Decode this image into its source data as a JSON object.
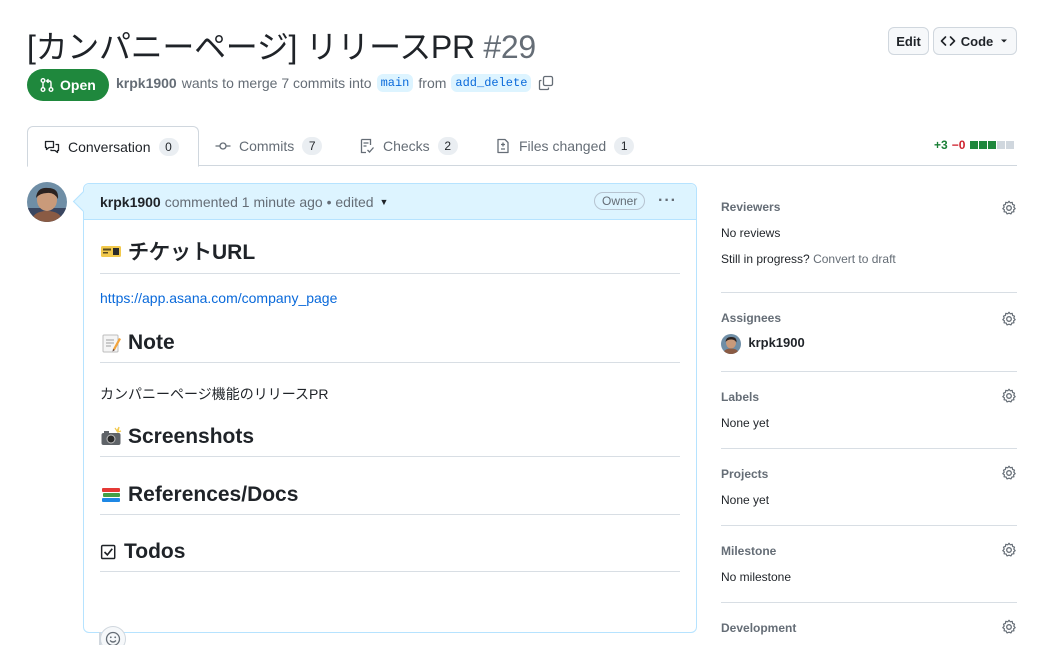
{
  "header": {
    "title": "[カンパニーページ] リリースPR",
    "number": "#29",
    "edit_label": "Edit",
    "code_label": "Code"
  },
  "status": {
    "state_label": "Open",
    "author": "krpk1900",
    "merge_text": "wants to merge 7 commits into",
    "base_branch": "main",
    "from_text": "from",
    "head_branch": "add_delete"
  },
  "tabs": [
    {
      "label": "Conversation",
      "count": "0",
      "icon": "comment-discussion-icon"
    },
    {
      "label": "Commits",
      "count": "7",
      "icon": "commit-icon"
    },
    {
      "label": "Checks",
      "count": "2",
      "icon": "checklist-icon"
    },
    {
      "label": "Files changed",
      "count": "1",
      "icon": "file-diff-icon"
    }
  ],
  "diffstat": {
    "additions": "+3",
    "deletions": "−0",
    "colors": [
      "#1f883d",
      "#1f883d",
      "#1f883d",
      "#d0d7de",
      "#d0d7de"
    ]
  },
  "comment": {
    "author": "krpk1900",
    "action": "commented",
    "time": "1 minute ago",
    "edited": "• edited",
    "role": "Owner",
    "sections": {
      "ticket_heading": "チケットURL",
      "ticket_url": "https://app.asana.com/company_page",
      "note_heading": "Note",
      "note_text": "カンパニーページ機能のリリースPR",
      "screenshots_heading": "Screenshots",
      "references_heading": "References/Docs",
      "todos_heading": "Todos"
    }
  },
  "sidebar": {
    "reviewers": {
      "title": "Reviewers",
      "value": "No reviews",
      "progress_text": "Still in progress?",
      "draft_link": "Convert to draft"
    },
    "assignees": {
      "title": "Assignees",
      "value": "krpk1900"
    },
    "labels": {
      "title": "Labels",
      "value": "None yet"
    },
    "projects": {
      "title": "Projects",
      "value": "None yet"
    },
    "milestone": {
      "title": "Milestone",
      "value": "No milestone"
    },
    "development": {
      "title": "Development"
    }
  },
  "colors": {
    "open_green": "#1f883d",
    "link_blue": "#0969da",
    "comment_header_bg": "#ddf4ff",
    "text_primary": "#1f2328",
    "text_muted": "#656d76"
  }
}
